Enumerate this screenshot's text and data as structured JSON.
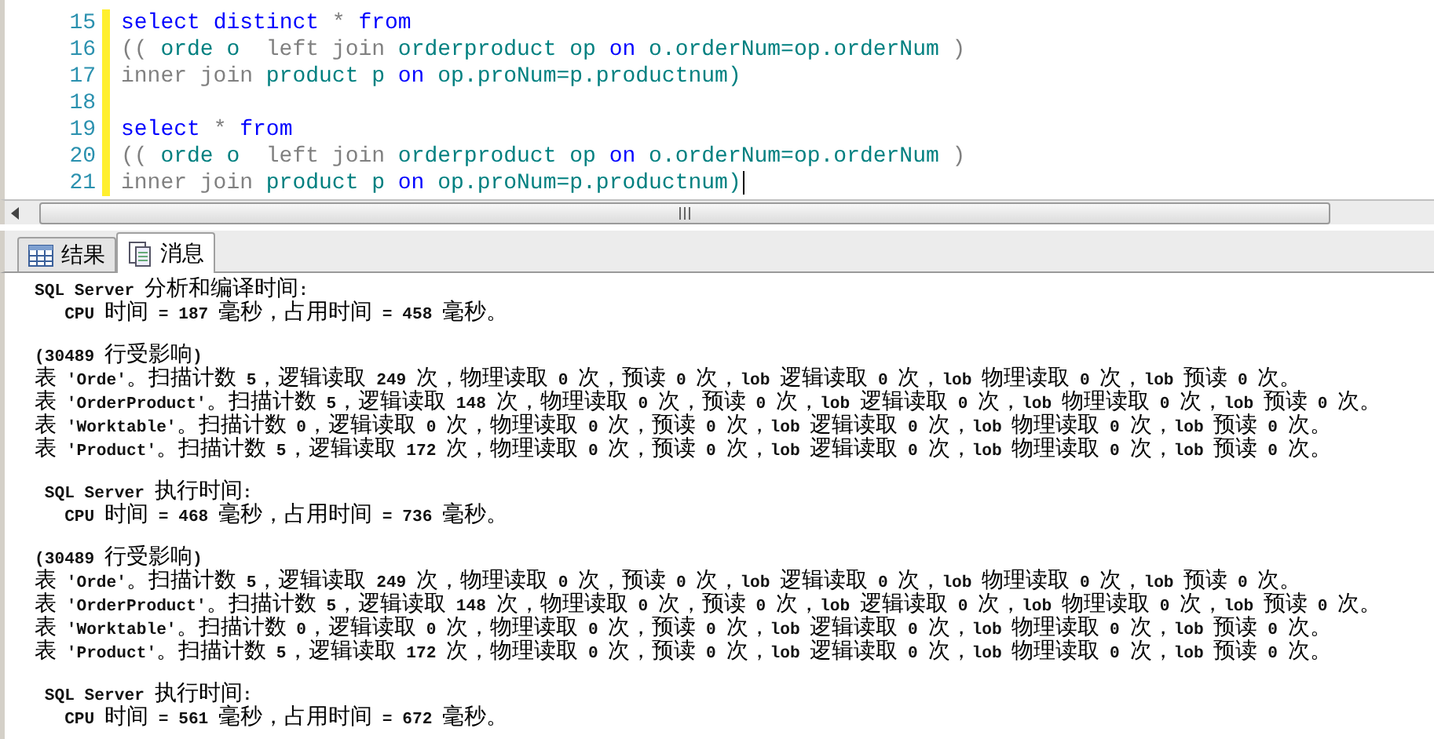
{
  "editor": {
    "lines": [
      {
        "number": "15",
        "tokens": [
          {
            "kind": "keyword",
            "text": "select"
          },
          {
            "kind": "keyword",
            "text": "distinct"
          },
          {
            "kind": "operator",
            "text": "*"
          },
          {
            "kind": "keyword",
            "text": "from"
          }
        ]
      },
      {
        "number": "16",
        "tokens": [
          {
            "kind": "operator",
            "text": "(("
          },
          {
            "kind": "identifier",
            "text": "orde"
          },
          {
            "kind": "identifier",
            "text": "o "
          },
          {
            "kind": "operator",
            "text": "left join"
          },
          {
            "kind": "identifier",
            "text": "orderproduct"
          },
          {
            "kind": "identifier",
            "text": "op"
          },
          {
            "kind": "keyword",
            "text": "on"
          },
          {
            "kind": "identifier",
            "text": "o.orderNum=op.orderNum"
          },
          {
            "kind": "operator",
            "text": ")"
          }
        ]
      },
      {
        "number": "17",
        "tokens": [
          {
            "kind": "operator",
            "text": "inner join"
          },
          {
            "kind": "identifier",
            "text": "product"
          },
          {
            "kind": "identifier",
            "text": "p"
          },
          {
            "kind": "keyword",
            "text": "on"
          },
          {
            "kind": "identifier",
            "text": "op.proNum=p.productnum)"
          }
        ]
      },
      {
        "number": "18"
      },
      {
        "number": "19",
        "tokens": [
          {
            "kind": "keyword",
            "text": "select"
          },
          {
            "kind": "operator",
            "text": "*"
          },
          {
            "kind": "keyword",
            "text": "from"
          }
        ]
      },
      {
        "number": "20",
        "tokens": [
          {
            "kind": "operator",
            "text": "(("
          },
          {
            "kind": "identifier",
            "text": "orde"
          },
          {
            "kind": "identifier",
            "text": "o "
          },
          {
            "kind": "operator",
            "text": "left join"
          },
          {
            "kind": "identifier",
            "text": "orderproduct"
          },
          {
            "kind": "identifier",
            "text": "op"
          },
          {
            "kind": "keyword",
            "text": "on"
          },
          {
            "kind": "identifier",
            "text": "o.orderNum=op.orderNum"
          },
          {
            "kind": "operator",
            "text": ")"
          }
        ]
      },
      {
        "number": "21",
        "cursor": true,
        "tokens": [
          {
            "kind": "operator",
            "text": "inner join"
          },
          {
            "kind": "identifier",
            "text": "product"
          },
          {
            "kind": "identifier",
            "text": "p"
          },
          {
            "kind": "keyword",
            "text": "on"
          },
          {
            "kind": "identifier",
            "text": "op.proNum=p.productnum)"
          }
        ]
      }
    ]
  },
  "tabs": [
    {
      "label": "结果",
      "kind": "grid",
      "selected": false
    },
    {
      "label": "消息",
      "kind": "document",
      "selected": true
    }
  ],
  "messages": [
    {
      "lines": [
        "SQL Server 分析和编译时间:",
        "   CPU 时间 = 187 毫秒，占用时间 = 458 毫秒。"
      ]
    },
    {
      "lines": [
        "(30489 行受影响)",
        "表 'Orde'。扫描计数 5，逻辑读取 249 次，物理读取 0 次，预读 0 次，lob 逻辑读取 0 次，lob 物理读取 0 次，lob 预读 0 次。",
        "表 'OrderProduct'。扫描计数 5，逻辑读取 148 次，物理读取 0 次，预读 0 次，lob 逻辑读取 0 次，lob 物理读取 0 次，lob 预读 0 次。",
        "表 'Worktable'。扫描计数 0，逻辑读取 0 次，物理读取 0 次，预读 0 次，lob 逻辑读取 0 次，lob 物理读取 0 次，lob 预读 0 次。",
        "表 'Product'。扫描计数 5，逻辑读取 172 次，物理读取 0 次，预读 0 次，lob 逻辑读取 0 次，lob 物理读取 0 次，lob 预读 0 次。"
      ]
    },
    {
      "lines": [
        " SQL Server 执行时间:",
        "   CPU 时间 = 468 毫秒，占用时间 = 736 毫秒。"
      ]
    },
    {
      "lines": [
        "(30489 行受影响)",
        "表 'Orde'。扫描计数 5，逻辑读取 249 次，物理读取 0 次，预读 0 次，lob 逻辑读取 0 次，lob 物理读取 0 次，lob 预读 0 次。",
        "表 'OrderProduct'。扫描计数 5，逻辑读取 148 次，物理读取 0 次，预读 0 次，lob 逻辑读取 0 次，lob 物理读取 0 次，lob 预读 0 次。",
        "表 'Worktable'。扫描计数 0，逻辑读取 0 次，物理读取 0 次，预读 0 次，lob 逻辑读取 0 次，lob 物理读取 0 次，lob 预读 0 次。",
        "表 'Product'。扫描计数 5，逻辑读取 172 次，物理读取 0 次，预读 0 次，lob 逻辑读取 0 次，lob 物理读取 0 次，lob 预读 0 次。"
      ]
    },
    {
      "lines": [
        " SQL Server 执行时间:",
        "   CPU 时间 = 561 毫秒，占用时间 = 672 毫秒。"
      ]
    }
  ]
}
